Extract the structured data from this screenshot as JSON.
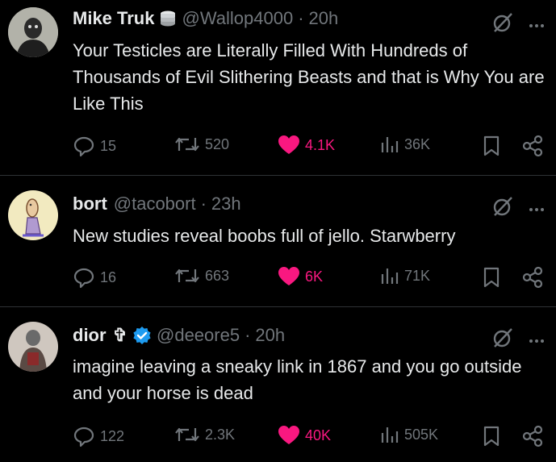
{
  "tweets": [
    {
      "name": "Mike Truk",
      "handle": "@Wallop4000",
      "separator": "·",
      "time": "20h",
      "text": "Your Testicles are Literally Filled With Hundreds of Thousands of Evil Slithering Beasts and that is Why You are Like This",
      "replies": "15",
      "reposts": "520",
      "likes": "4.1K",
      "views": "36K"
    },
    {
      "name": "bort",
      "handle": "@tacobort",
      "separator": "·",
      "time": "23h",
      "text": "New studies reveal boobs full of jello. Starwberry",
      "replies": "16",
      "reposts": "663",
      "likes": "6K",
      "views": "71K"
    },
    {
      "name": "dior",
      "name_glyph": "✞",
      "handle": "@deeore5",
      "separator": "·",
      "time": "20h",
      "text": "imagine leaving a sneaky link in 1867 and you go outside and your horse is dead",
      "replies": "122",
      "reposts": "2.3K",
      "likes": "40K",
      "views": "505K"
    }
  ],
  "colors": {
    "like": "#f91880",
    "muted": "#71767b",
    "text": "#e7e9ea",
    "verified": "#1d9bf0",
    "divider": "#2f3336"
  }
}
